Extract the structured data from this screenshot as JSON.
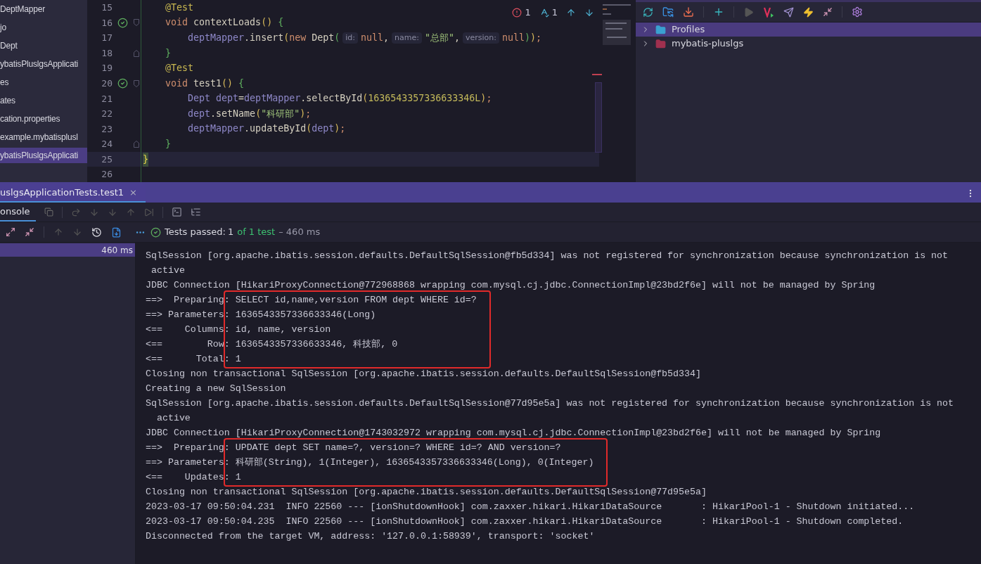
{
  "project_tree": {
    "items": [
      {
        "label": "DeptMapper",
        "selected": false
      },
      {
        "label": "jo",
        "selected": false
      },
      {
        "label": "Dept",
        "selected": false
      },
      {
        "label": "ybatisPluslgsApplicati",
        "selected": false
      },
      {
        "label": "es",
        "selected": false
      },
      {
        "label": "ates",
        "selected": false
      },
      {
        "label": "cation.properties",
        "selected": false
      },
      {
        "label": "example.mybatisplusl",
        "selected": false
      },
      {
        "label": "ybatisPluslgsApplicati",
        "selected": true
      }
    ]
  },
  "editor": {
    "problems": {
      "errors": "1",
      "typos": "1"
    },
    "lines": [
      {
        "number": "15",
        "current": false,
        "passed": false,
        "fold_start": false,
        "fold_end": false,
        "tokens": [
          {
            "kind": "annotation",
            "text": "    @Test"
          }
        ]
      },
      {
        "number": "16",
        "current": false,
        "passed": true,
        "fold_start": true,
        "fold_end": false,
        "tokens": [
          {
            "kind": "keyword",
            "text": "    void"
          },
          {
            "kind": "plain",
            "text": " contextLoads"
          },
          {
            "kind": "brace_yellow",
            "text": "()"
          },
          {
            "kind": "brace_green",
            "text": " {"
          }
        ]
      },
      {
        "number": "17",
        "current": false,
        "passed": false,
        "fold_start": false,
        "fold_end": false,
        "tokens": [
          {
            "kind": "field",
            "text": "        deptMapper"
          },
          {
            "kind": "plain",
            "text": ".insert"
          },
          {
            "kind": "brace_yellow",
            "text": "("
          },
          {
            "kind": "keyword",
            "text": "new"
          },
          {
            "kind": "plain",
            "text": " Dept"
          },
          {
            "kind": "brace_green",
            "text": "("
          },
          {
            "kind": "hint",
            "text": "id:"
          },
          {
            "kind": "keyword",
            "text": "null"
          },
          {
            "kind": "plain",
            "text": ","
          },
          {
            "kind": "hint",
            "text": "name:"
          },
          {
            "kind": "string",
            "text": "\"总部\""
          },
          {
            "kind": "plain",
            "text": ","
          },
          {
            "kind": "hint",
            "text": "version:"
          },
          {
            "kind": "keyword",
            "text": "null"
          },
          {
            "kind": "brace_green",
            "text": ")"
          },
          {
            "kind": "brace_yellow",
            "text": ")"
          },
          {
            "kind": "keyword",
            "text": ";"
          }
        ]
      },
      {
        "number": "18",
        "current": false,
        "passed": false,
        "fold_start": false,
        "fold_end": true,
        "tokens": [
          {
            "kind": "brace_green",
            "text": "    }"
          }
        ]
      },
      {
        "number": "19",
        "current": false,
        "passed": false,
        "fold_start": false,
        "fold_end": false,
        "tokens": [
          {
            "kind": "annotation",
            "text": "    @Test"
          }
        ]
      },
      {
        "number": "20",
        "current": false,
        "passed": true,
        "fold_start": true,
        "fold_end": false,
        "tokens": [
          {
            "kind": "keyword",
            "text": "    void"
          },
          {
            "kind": "plain",
            "text": " test1"
          },
          {
            "kind": "brace_yellow",
            "text": "()"
          },
          {
            "kind": "brace_green",
            "text": " {"
          }
        ]
      },
      {
        "number": "21",
        "current": false,
        "passed": false,
        "fold_start": false,
        "fold_end": false,
        "tokens": [
          {
            "kind": "field",
            "text": "        Dept dept"
          },
          {
            "kind": "plain",
            "text": "="
          },
          {
            "kind": "field",
            "text": "deptMapper"
          },
          {
            "kind": "plain",
            "text": ".selectById"
          },
          {
            "kind": "brace_yellow",
            "text": "("
          },
          {
            "kind": "number",
            "text": "1636543357336633346L"
          },
          {
            "kind": "brace_yellow",
            "text": ")"
          },
          {
            "kind": "keyword",
            "text": ";"
          }
        ]
      },
      {
        "number": "22",
        "current": false,
        "passed": false,
        "fold_start": false,
        "fold_end": false,
        "tokens": [
          {
            "kind": "field",
            "text": "        dept"
          },
          {
            "kind": "plain",
            "text": ".setName"
          },
          {
            "kind": "brace_yellow",
            "text": "("
          },
          {
            "kind": "string",
            "text": "\"科研部\""
          },
          {
            "kind": "brace_yellow",
            "text": ")"
          },
          {
            "kind": "keyword",
            "text": ";"
          }
        ]
      },
      {
        "number": "23",
        "current": false,
        "passed": false,
        "fold_start": false,
        "fold_end": false,
        "tokens": [
          {
            "kind": "field",
            "text": "        deptMapper"
          },
          {
            "kind": "plain",
            "text": ".updateById"
          },
          {
            "kind": "brace_yellow",
            "text": "("
          },
          {
            "kind": "field",
            "text": "dept"
          },
          {
            "kind": "brace_yellow",
            "text": ")"
          },
          {
            "kind": "keyword",
            "text": ";"
          }
        ]
      },
      {
        "number": "24",
        "current": false,
        "passed": false,
        "fold_start": false,
        "fold_end": true,
        "tokens": [
          {
            "kind": "brace_green",
            "text": "    }"
          }
        ]
      },
      {
        "number": "25",
        "current": true,
        "passed": false,
        "fold_start": false,
        "fold_end": false,
        "tokens": [
          {
            "kind": "brace_match",
            "text": "}"
          }
        ]
      },
      {
        "number": "26",
        "current": false,
        "passed": false,
        "fold_start": false,
        "fold_end": false
      }
    ]
  },
  "maven_panel": {
    "items": [
      {
        "label": "Profiles",
        "kind": "profiles",
        "selected": true
      },
      {
        "label": "mybatis-pluslgs",
        "kind": "module",
        "selected": false
      }
    ]
  },
  "run_panel": {
    "tabs": [
      {
        "label": "uslgsApplicationTests.test1",
        "close": "×",
        "selected": true
      }
    ],
    "console_tab": {
      "label": "onsole",
      "selected": true
    },
    "status": {
      "label": "Tests passed:",
      "count": "1",
      "total": "of 1 test",
      "duration": "– 460 ms"
    },
    "test_tree": [
      {
        "duration": "460 ms",
        "selected": true
      }
    ],
    "console": {
      "blocks": [
        {
          "framed": false,
          "lines": [
            "SqlSession [org.apache.ibatis.session.defaults.DefaultSqlSession@fb5d334] was not registered for synchronization because synchronization is not",
            " active",
            "JDBC Connection [HikariProxyConnection@772968868 wrapping com.mysql.cj.jdbc.ConnectionImpl@23bd2f6e] will not be managed by Spring"
          ]
        },
        {
          "framed": true,
          "lines": [
            "==>  Preparing: SELECT id,name,version FROM dept WHERE id=?",
            "==> Parameters: 1636543357336633346(Long)",
            "<==    Columns: id, name, version",
            "<==        Row: 1636543357336633346, 科技部, 0",
            "<==      Total: 1"
          ]
        },
        {
          "framed": false,
          "lines": [
            "Closing non transactional SqlSession [org.apache.ibatis.session.defaults.DefaultSqlSession@fb5d334]",
            "Creating a new SqlSession",
            "SqlSession [org.apache.ibatis.session.defaults.DefaultSqlSession@77d95e5a] was not registered for synchronization because synchronization is not",
            "  active",
            "JDBC Connection [HikariProxyConnection@1743032972 wrapping com.mysql.cj.jdbc.ConnectionImpl@23bd2f6e] will not be managed by Spring"
          ]
        },
        {
          "framed": true,
          "lines": [
            "==>  Preparing: UPDATE dept SET name=?, version=? WHERE id=? AND version=?",
            "==> Parameters: 科研部(String), 1(Integer), 1636543357336633346(Long), 0(Integer)",
            "<==    Updates: 1"
          ]
        },
        {
          "framed": false,
          "lines": [
            "Closing non transactional SqlSession [org.apache.ibatis.session.defaults.DefaultSqlSession@77d95e5a]",
            "2023-03-17 09:50:04.231  INFO 22560 --- [ionShutdownHook] com.zaxxer.hikari.HikariDataSource       : HikariPool-1 - Shutdown initiated...",
            "2023-03-17 09:50:04.235  INFO 22560 --- [ionShutdownHook] com.zaxxer.hikari.HikariDataSource       : HikariPool-1 - Shutdown completed.",
            "Disconnected from the target VM, address: '127.0.0.1:58939', transport: 'socket'"
          ]
        }
      ]
    }
  }
}
